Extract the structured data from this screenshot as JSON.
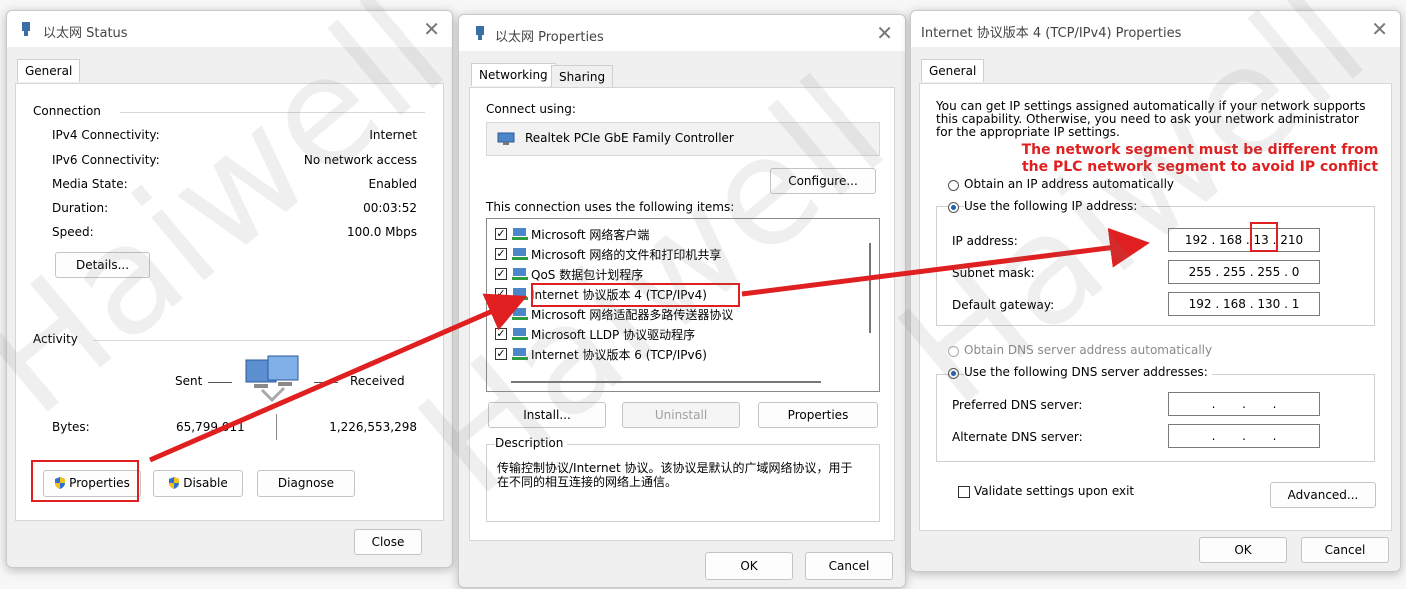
{
  "status_dialog": {
    "title": "以太网 Status",
    "tab": "General",
    "connection_label": "Connection",
    "rows": [
      {
        "label": "IPv4 Connectivity:",
        "value": "Internet"
      },
      {
        "label": "IPv6 Connectivity:",
        "value": "No network access"
      },
      {
        "label": "Media State:",
        "value": "Enabled"
      },
      {
        "label": "Duration:",
        "value": "00:03:52"
      },
      {
        "label": "Speed:",
        "value": "100.0 Mbps"
      }
    ],
    "details_button": "Details...",
    "activity_label": "Activity",
    "sent_label": "Sent",
    "received_label": "Received",
    "bytes_label": "Bytes:",
    "bytes_sent": "65,799,011",
    "bytes_received": "1,226,553,298",
    "properties_button": "Properties",
    "disable_button": "Disable",
    "diagnose_button": "Diagnose",
    "close_button": "Close"
  },
  "properties_dialog": {
    "title": "以太网 Properties",
    "tabs": [
      "Networking",
      "Sharing"
    ],
    "connect_using_label": "Connect using:",
    "adapter": "Realtek PCIe GbE Family Controller",
    "configure_button": "Configure...",
    "items_label": "This connection uses the following items:",
    "items": [
      {
        "label": "Microsoft 网络客户端",
        "checked": true
      },
      {
        "label": "Microsoft 网络的文件和打印机共享",
        "checked": true
      },
      {
        "label": "QoS 数据包计划程序",
        "checked": true
      },
      {
        "label": "Internet 协议版本 4 (TCP/IPv4)",
        "checked": true
      },
      {
        "label": "Microsoft 网络适配器多路传送器协议",
        "checked": false
      },
      {
        "label": "Microsoft LLDP 协议驱动程序",
        "checked": true
      },
      {
        "label": "Internet 协议版本 6 (TCP/IPv6)",
        "checked": true
      }
    ],
    "install_button": "Install...",
    "uninstall_button": "Uninstall",
    "properties_button": "Properties",
    "description_label": "Description",
    "description_text": "传输控制协议/Internet 协议。该协议是默认的广域网络协议，用于在不同的相互连接的网络上通信。",
    "ok_button": "OK",
    "cancel_button": "Cancel"
  },
  "ipv4_dialog": {
    "title": "Internet 协议版本 4 (TCP/IPv4) Properties",
    "tab": "General",
    "intro": "You can get IP settings assigned automatically if your network supports this capability. Otherwise, you need to ask your network administrator for the appropriate IP settings.",
    "auto_ip_label": "Obtain an IP address automatically",
    "manual_ip_label": "Use the following IP address:",
    "ip_address_label": "IP address:",
    "ip_address": [
      "192",
      "168",
      "13",
      "210"
    ],
    "subnet_label": "Subnet mask:",
    "subnet": [
      "255",
      "255",
      "255",
      "0"
    ],
    "gateway_label": "Default gateway:",
    "gateway": [
      "192",
      "168",
      "130",
      "1"
    ],
    "auto_dns_label": "Obtain DNS server address automatically",
    "manual_dns_label": "Use the following DNS server addresses:",
    "preferred_dns_label": "Preferred DNS server:",
    "alternate_dns_label": "Alternate DNS server:",
    "validate_label": "Validate settings upon exit",
    "advanced_button": "Advanced...",
    "ok_button": "OK",
    "cancel_button": "Cancel"
  },
  "annotation": {
    "line1": "The network segment must be different from",
    "line2": "the PLC network segment to avoid IP conflict",
    "color": "#e02020"
  },
  "watermark": "Haiwell"
}
